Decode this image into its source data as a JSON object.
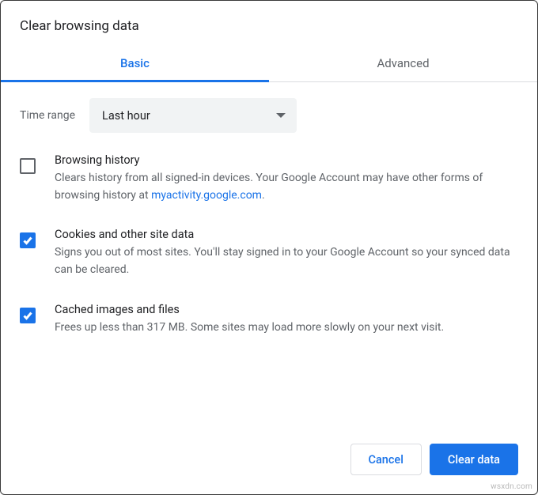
{
  "title": "Clear browsing data",
  "tabs": {
    "basic": "Basic",
    "advanced": "Advanced"
  },
  "time": {
    "label": "Time range",
    "value": "Last hour"
  },
  "options": {
    "browsing": {
      "checked": false,
      "title": "Browsing history",
      "desc_pre": "Clears history from all signed-in devices. Your Google Account may have other forms of browsing history at ",
      "link": "myactivity.google.com",
      "desc_post": "."
    },
    "cookies": {
      "checked": true,
      "title": "Cookies and other site data",
      "desc": "Signs you out of most sites. You'll stay signed in to your Google Account so your synced data can be cleared."
    },
    "cache": {
      "checked": true,
      "title": "Cached images and files",
      "desc": "Frees up less than 317 MB. Some sites may load more slowly on your next visit."
    }
  },
  "buttons": {
    "cancel": "Cancel",
    "clear": "Clear data"
  },
  "watermark": "wsxdn.com"
}
